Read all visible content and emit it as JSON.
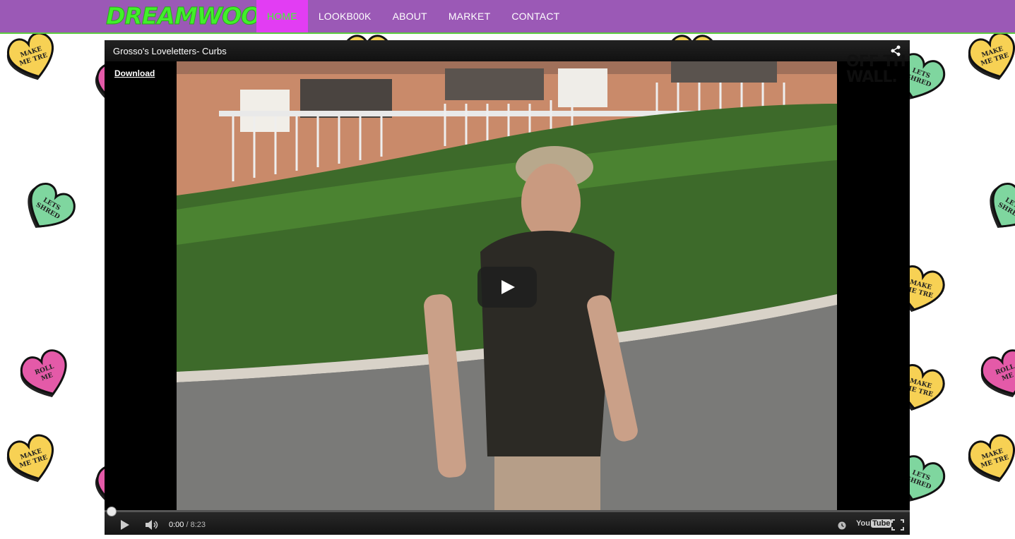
{
  "brand": {
    "logo_text": "DREAMWOOD",
    "color": "#41f02a"
  },
  "nav": {
    "items": [
      {
        "label": "HOME",
        "active": true
      },
      {
        "label": "LOOKB00K",
        "active": false
      },
      {
        "label": "ABOUT",
        "active": false
      },
      {
        "label": "MARKET",
        "active": false
      },
      {
        "label": "CONTACT",
        "active": false
      }
    ],
    "background": "#9b59b6",
    "active_background": "#e23df3"
  },
  "background_hearts": [
    {
      "text_line1": "MAKE",
      "text_line2": "ME TRE",
      "color": "#f7d154"
    },
    {
      "text_line1": "LETS",
      "text_line2": "SHRED",
      "color": "#7fd69f"
    },
    {
      "text_line1": "ROLL",
      "text_line2": "ME",
      "color": "#e45aa8"
    }
  ],
  "player": {
    "title": "Grosso's Loveletters- Curbs",
    "download_label": "Download",
    "watermark_line1": "OFF TH",
    "watermark_line2": "WALL.",
    "current_time": "0:00",
    "separator": " / ",
    "duration": "8:23",
    "progress": 0.0,
    "youtube_label_a": "You",
    "youtube_label_b": "Tube"
  }
}
